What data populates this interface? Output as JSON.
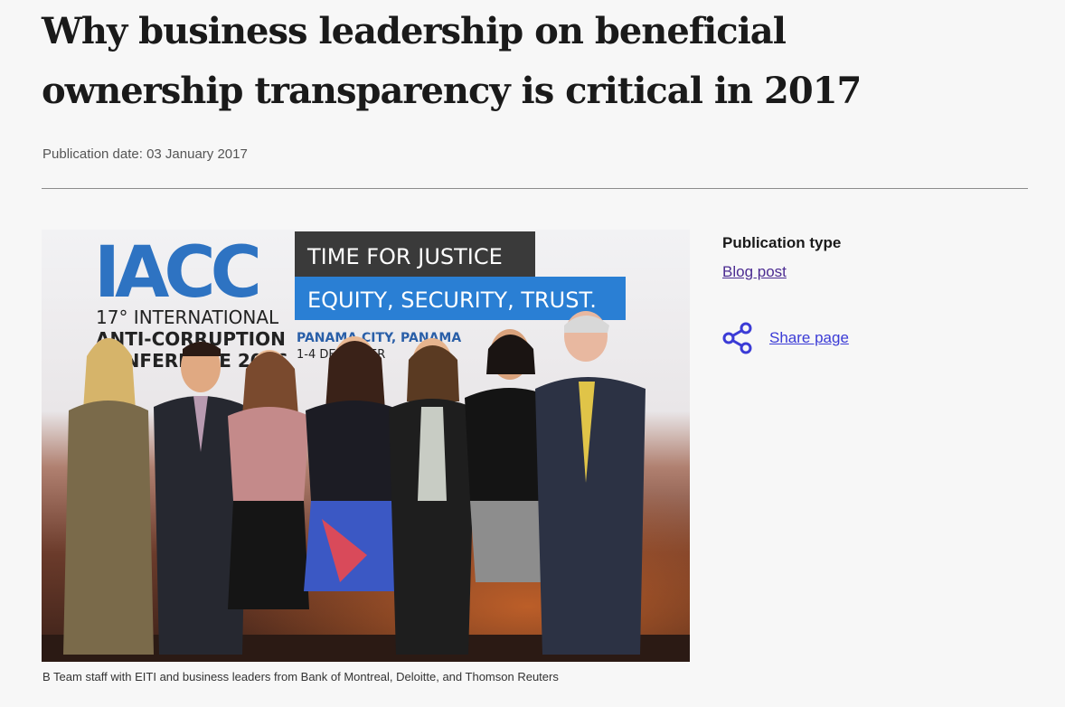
{
  "article": {
    "title": "Why business leadership on beneficial ownership transparency is critical in 2017",
    "publication_date": "Publication date: 03 January 2017",
    "image": {
      "backdrop": {
        "logo": "IACC",
        "conference_line1": "17° INTERNATIONAL",
        "conference_line2": "ANTI-CORRUPTION",
        "conference_line3": "CONFERENCE 2016",
        "banner_top": "TIME FOR JUSTICE",
        "banner_bottom": "EQUITY, SECURITY, TRUST.",
        "location": "PANAMA CITY, PANAMA",
        "dates": "1-4 DECEMBER"
      }
    },
    "caption": "B Team staff with EITI and business leaders from Bank of Montreal, Deloitte, and Thomson Reuters"
  },
  "sidebar": {
    "publication_type_heading": "Publication type",
    "publication_type_value": "Blog post",
    "share_label": "Share page",
    "share_icon": "share-icon"
  },
  "colors": {
    "background": "#f7f7f7",
    "link": "#4c2c92",
    "share": "#3b3bd6",
    "iacc_blue": "#2e73c2",
    "banner_dark": "#3a3a3a",
    "banner_blue": "#2a7fd4"
  }
}
